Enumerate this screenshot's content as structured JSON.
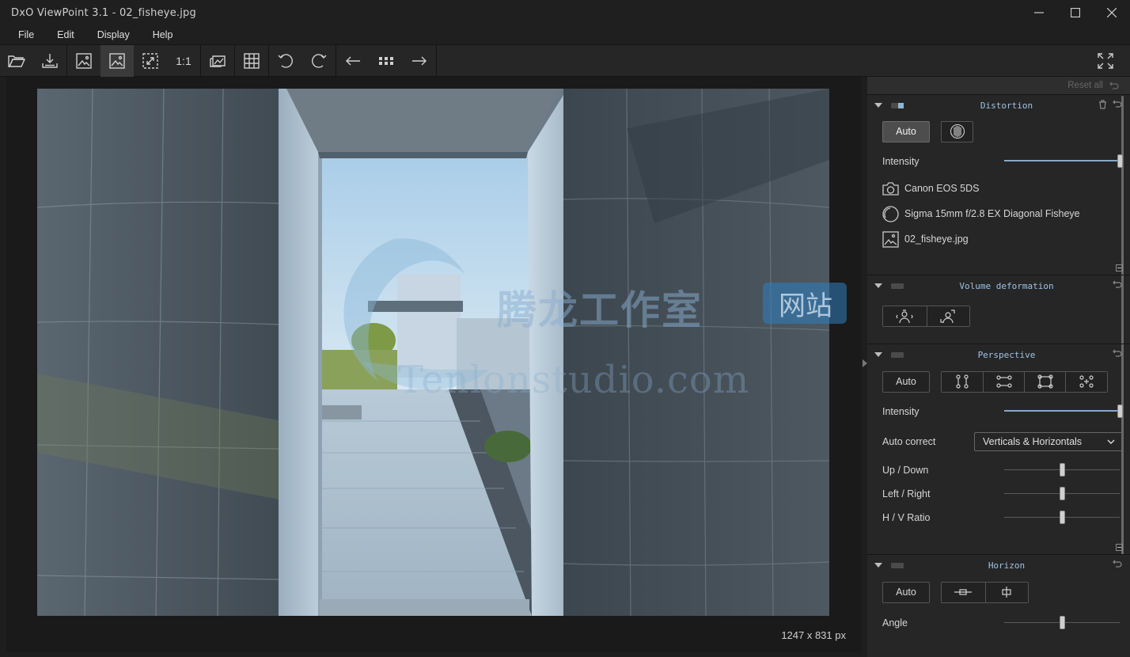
{
  "window": {
    "title": "DxO ViewPoint 3.1 - 02_fisheye.jpg"
  },
  "menu": [
    "File",
    "Edit",
    "Display",
    "Help"
  ],
  "toolbar": {
    "one_to_one": "1:1"
  },
  "viewer": {
    "image_size": "1247 x 831 px"
  },
  "panel": {
    "reset_all": "Reset all",
    "distortion": {
      "title": "Distortion",
      "auto_label": "Auto",
      "intensity_label": "Intensity",
      "intensity_value": 1.0,
      "camera": "Canon EOS 5DS",
      "lens": "Sigma 15mm f/2.8 EX Diagonal Fisheye",
      "file": "02_fisheye.jpg"
    },
    "volume": {
      "title": "Volume deformation"
    },
    "perspective": {
      "title": "Perspective",
      "auto_label": "Auto",
      "intensity_label": "Intensity",
      "intensity_value": 1.0,
      "auto_correct_label": "Auto correct",
      "auto_correct_value": "Verticals & Horizontals",
      "up_down_label": "Up / Down",
      "up_down_value": 0.5,
      "left_right_label": "Left / Right",
      "left_right_value": 0.5,
      "hv_ratio_label": "H / V Ratio",
      "hv_ratio_value": 0.5
    },
    "horizon": {
      "title": "Horizon",
      "auto_label": "Auto",
      "angle_label": "Angle",
      "angle_value": 0.5
    }
  },
  "watermark": {
    "cn": "腾龙工作室",
    "badge": "网站",
    "url": "Tenlonstudio.com"
  },
  "colors": {
    "accent": "#9fc3e4",
    "slider_fill": "#86a9c7",
    "panel_bg": "#262626"
  }
}
